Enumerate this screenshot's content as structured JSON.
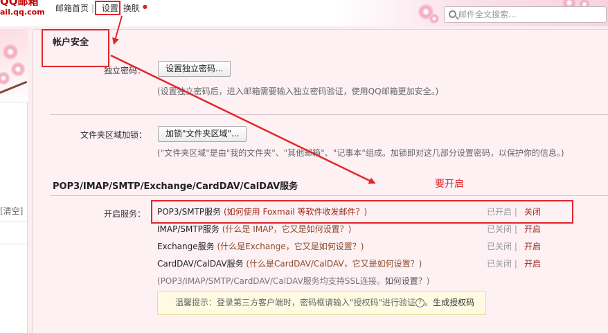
{
  "header": {
    "logo_text": "QQ邮箱",
    "logo_domain": "ail.qq.com",
    "nav": {
      "home": "邮箱首页",
      "separator": "|",
      "settings": "设置",
      "skin": "换肤"
    },
    "search_placeholder": "邮件全文搜索..."
  },
  "sidebar": {
    "clear": "[清空]"
  },
  "account_security": {
    "title": "帐户安全",
    "independent_password": {
      "label": "独立密码：",
      "button": "设置独立密码...",
      "hint": "(设置独立密码后，进入邮箱需要输入独立密码验证，使用QQ邮箱更加安全。)"
    },
    "folder_lock": {
      "label": "文件夹区域加锁：",
      "button": "加锁\"文件夹区域\"...",
      "hint": "(\"文件夹区域\"是由\"我的文件夹\"、\"其他邮箱\"、\"记事本\"组成。加锁即对这几部分设置密码，以保护你的信息。)"
    }
  },
  "protocols": {
    "title": "POP3/IMAP/SMTP/Exchange/CardDAV/CalDAV服务",
    "services_label": "开启服务：",
    "services": [
      {
        "name": "POP3/SMTP服务",
        "help": "(如何使用 Foxmail 等软件收发邮件？)",
        "state": "已开启",
        "sep": "|",
        "action": "关闭"
      },
      {
        "name": "IMAP/SMTP服务",
        "help": "(什么是 IMAP，它又是如何设置？)",
        "state": "已关闭",
        "sep": "|",
        "action": "开启"
      },
      {
        "name": "Exchange服务",
        "help": "(什么是Exchange，它又是如何设置？)",
        "state": "已关闭",
        "sep": "|",
        "action": "开启"
      },
      {
        "name": "CardDAV/CalDAV服务",
        "help": "(什么是CardDAV/CalDAV，它又是如何设置？)",
        "state": "已关闭",
        "sep": "|",
        "action": "开启"
      }
    ],
    "ssl_note": "(POP3/IMAP/SMTP/CardDAV/CalDAV服务均支持SSL连接。",
    "ssl_link": "如何设置？",
    "ssl_close": ")",
    "notice": {
      "text": "温馨提示：登录第三方客户端时，密码框请输入\"授权码\"进行验证",
      "help_glyph": "?",
      "punct": "。",
      "link": "生成授权码"
    }
  },
  "annotation": {
    "text": "要开启",
    "color": "#e0262b"
  },
  "colors": {
    "accent_red": "#a0281b",
    "brand_red": "#c00000",
    "panel_bg": "#fdf1f4"
  }
}
